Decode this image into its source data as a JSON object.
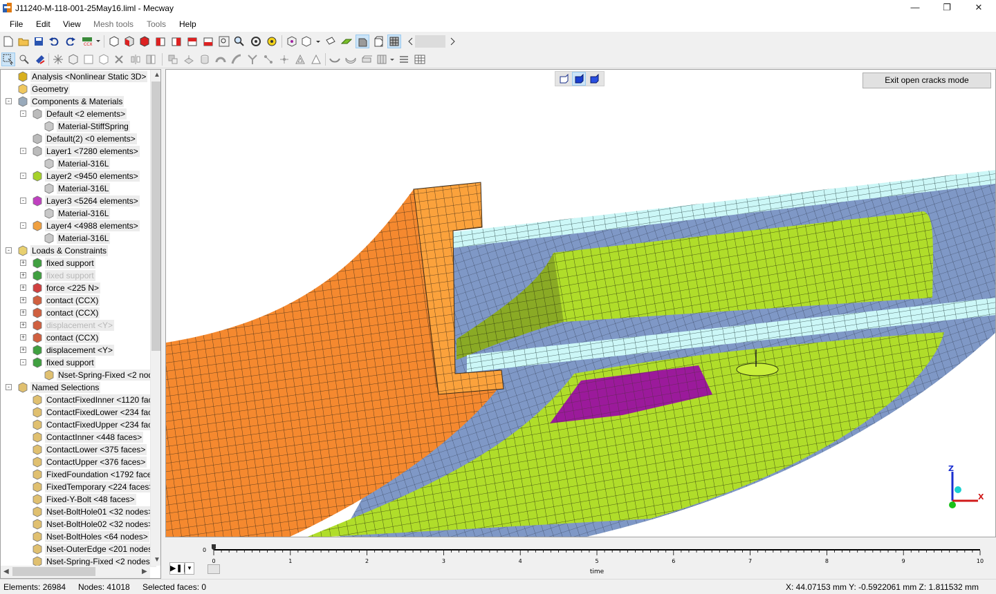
{
  "window": {
    "title": "J11240-M-118-001-25May16.liml - Mecway",
    "minimize": "—",
    "maximize": "❐",
    "close": "✕"
  },
  "menu": [
    "File",
    "Edit",
    "View",
    "Mesh tools",
    "Tools",
    "Help"
  ],
  "tree": [
    {
      "label": "Analysis <Nonlinear Static 3D>",
      "icon": "analysis-icon",
      "level": 1,
      "expander": ""
    },
    {
      "label": "Geometry",
      "icon": "folder-icon",
      "level": 1,
      "expander": ""
    },
    {
      "label": "Components & Materials",
      "icon": "components-icon",
      "level": 1,
      "expander": "-"
    },
    {
      "label": "Default <2 elements>",
      "icon": "component-icon",
      "level": 2,
      "expander": "-"
    },
    {
      "label": "Material-StiffSpring",
      "icon": "material-icon",
      "level": 3,
      "expander": ""
    },
    {
      "label": "Default(2) <0 elements>",
      "icon": "component-icon",
      "level": 2,
      "expander": ""
    },
    {
      "label": "Layer1 <7280 elements>",
      "icon": "component-icon",
      "level": 2,
      "expander": "-"
    },
    {
      "label": "Material-316L",
      "icon": "material-icon",
      "level": 3,
      "expander": ""
    },
    {
      "label": "Layer2 <9450 elements>",
      "icon": "component-green-icon",
      "level": 2,
      "expander": "-"
    },
    {
      "label": "Material-316L",
      "icon": "material-icon",
      "level": 3,
      "expander": ""
    },
    {
      "label": "Layer3 <5264 elements>",
      "icon": "component-magenta-icon",
      "level": 2,
      "expander": "-"
    },
    {
      "label": "Material-316L",
      "icon": "material-icon",
      "level": 3,
      "expander": ""
    },
    {
      "label": "Layer4 <4988 elements>",
      "icon": "component-orange-icon",
      "level": 2,
      "expander": "-"
    },
    {
      "label": "Material-316L",
      "icon": "material-icon",
      "level": 3,
      "expander": ""
    },
    {
      "label": "Loads & Constraints",
      "icon": "loads-icon",
      "level": 1,
      "expander": "-"
    },
    {
      "label": "fixed support",
      "icon": "fixed-support-icon",
      "level": 2,
      "expander": "+"
    },
    {
      "label": "fixed support",
      "icon": "fixed-support-icon",
      "level": 2,
      "expander": "+",
      "gray": true
    },
    {
      "label": "force <225 N>",
      "icon": "force-icon",
      "level": 2,
      "expander": "+"
    },
    {
      "label": "contact (CCX)",
      "icon": "contact-icon",
      "level": 2,
      "expander": "+"
    },
    {
      "label": "contact (CCX)",
      "icon": "contact-icon",
      "level": 2,
      "expander": "+"
    },
    {
      "label": "displacement <Y>",
      "icon": "contact-icon",
      "level": 2,
      "expander": "+",
      "gray": true
    },
    {
      "label": "contact (CCX)",
      "icon": "contact-icon",
      "level": 2,
      "expander": "+"
    },
    {
      "label": "displacement <Y>",
      "icon": "displacement-icon",
      "level": 2,
      "expander": "+"
    },
    {
      "label": "fixed support",
      "icon": "fixed-support-icon",
      "level": 2,
      "expander": "-"
    },
    {
      "label": "Nset-Spring-Fixed <2 nod",
      "icon": "selection-icon",
      "level": 3,
      "expander": ""
    },
    {
      "label": "Named Selections",
      "icon": "named-selections-icon",
      "level": 1,
      "expander": "-"
    },
    {
      "label": "ContactFixedInner <1120 face",
      "icon": "selection-icon",
      "level": 2,
      "expander": ""
    },
    {
      "label": "ContactFixedLower <234 face",
      "icon": "selection-icon",
      "level": 2,
      "expander": ""
    },
    {
      "label": "ContactFixedUpper <234 face",
      "icon": "selection-icon",
      "level": 2,
      "expander": ""
    },
    {
      "label": "ContactInner <448 faces>",
      "icon": "selection-icon",
      "level": 2,
      "expander": ""
    },
    {
      "label": "ContactLower <375 faces>",
      "icon": "selection-icon",
      "level": 2,
      "expander": ""
    },
    {
      "label": "ContactUpper <376 faces>",
      "icon": "selection-icon",
      "level": 2,
      "expander": ""
    },
    {
      "label": "FixedFoundation <1792 faces",
      "icon": "selection-icon",
      "level": 2,
      "expander": ""
    },
    {
      "label": "FixedTemporary <224 faces>",
      "icon": "selection-icon",
      "level": 2,
      "expander": ""
    },
    {
      "label": "Fixed-Y-Bolt <48 faces>",
      "icon": "selection-icon",
      "level": 2,
      "expander": ""
    },
    {
      "label": "Nset-BoltHole01 <32 nodes>",
      "icon": "selection-icon",
      "level": 2,
      "expander": ""
    },
    {
      "label": "Nset-BoltHole02 <32 nodes>",
      "icon": "selection-icon",
      "level": 2,
      "expander": ""
    },
    {
      "label": "Nset-BoltHoles <64 nodes>",
      "icon": "selection-icon",
      "level": 2,
      "expander": ""
    },
    {
      "label": "Nset-OuterEdge <201 nodes:",
      "icon": "selection-icon",
      "level": 2,
      "expander": ""
    },
    {
      "label": "Nset-Spring-Fixed <2 nodes>",
      "icon": "selection-icon",
      "level": 2,
      "expander": ""
    }
  ],
  "viewport": {
    "exit_button": "Exit open cracks mode",
    "axes": {
      "z": "Z",
      "x": "X"
    }
  },
  "timeline": {
    "start_value": "0",
    "ticks": [
      "0",
      "1",
      "2",
      "3",
      "4",
      "5",
      "6",
      "7",
      "8",
      "9",
      "10"
    ],
    "axis_label": "time",
    "play_label": "▶❚❚",
    "position": 0
  },
  "status": {
    "elements": "Elements: 26984",
    "nodes": "Nodes: 41018",
    "selected": "Selected faces: 0",
    "coords": "X: 44.07153 mm Y: -0.5922061 mm Z: 1.811532 mm"
  },
  "colors": {
    "orange": "#f5892f",
    "orange_dark": "#d97420",
    "green": "#b0dd2a",
    "green_dark": "#8aaa25",
    "blue": "#7f98c6",
    "cyan": "#ccf7f7",
    "magenta": "#9b1a9b"
  }
}
